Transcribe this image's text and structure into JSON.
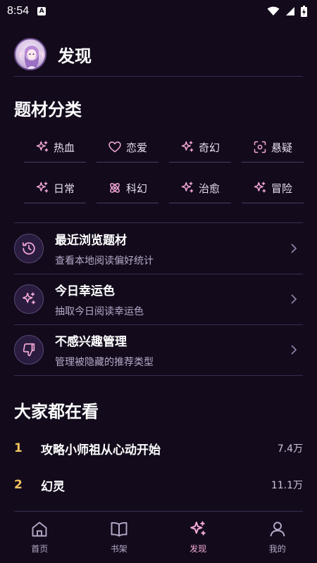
{
  "status_bar": {
    "time": "8:54",
    "badge": "A"
  },
  "header": {
    "title": "发现"
  },
  "genres": {
    "title": "题材分类",
    "items": [
      {
        "label": "热血",
        "icon": "sparkle-icon"
      },
      {
        "label": "恋爱",
        "icon": "heart-icon"
      },
      {
        "label": "奇幻",
        "icon": "sparkle-icon"
      },
      {
        "label": "悬疑",
        "icon": "scan-face-icon"
      },
      {
        "label": "日常",
        "icon": "sparkle-icon"
      },
      {
        "label": "科幻",
        "icon": "atom-icon"
      },
      {
        "label": "治愈",
        "icon": "sparkle-icon"
      },
      {
        "label": "冒险",
        "icon": "sparkle-icon"
      }
    ]
  },
  "features": [
    {
      "title": "最近浏览题材",
      "subtitle": "查看本地阅读偏好统计",
      "icon": "history-icon"
    },
    {
      "title": "今日幸运色",
      "subtitle": "抽取今日阅读幸运色",
      "icon": "sparkle-icon"
    },
    {
      "title": "不感兴趣管理",
      "subtitle": "管理被隐藏的推荐类型",
      "icon": "thumbs-down-icon"
    }
  ],
  "popular": {
    "title": "大家都在看",
    "items": [
      {
        "rank": "1",
        "title": "攻略小师祖从心动开始",
        "count": "7.4万"
      },
      {
        "rank": "2",
        "title": "幻灵",
        "count": "11.1万"
      }
    ]
  },
  "tabs": [
    {
      "label": "首页",
      "icon": "home-icon",
      "active": false
    },
    {
      "label": "书架",
      "icon": "book-icon",
      "active": false
    },
    {
      "label": "发现",
      "icon": "sparkle-icon",
      "active": true
    },
    {
      "label": "我的",
      "icon": "user-icon",
      "active": false
    }
  ],
  "colors": {
    "background": "#130b1c",
    "accent_pink": "#f4a9d8",
    "rank_gold": "#f0c25e",
    "muted_text": "#b7a9c8"
  }
}
